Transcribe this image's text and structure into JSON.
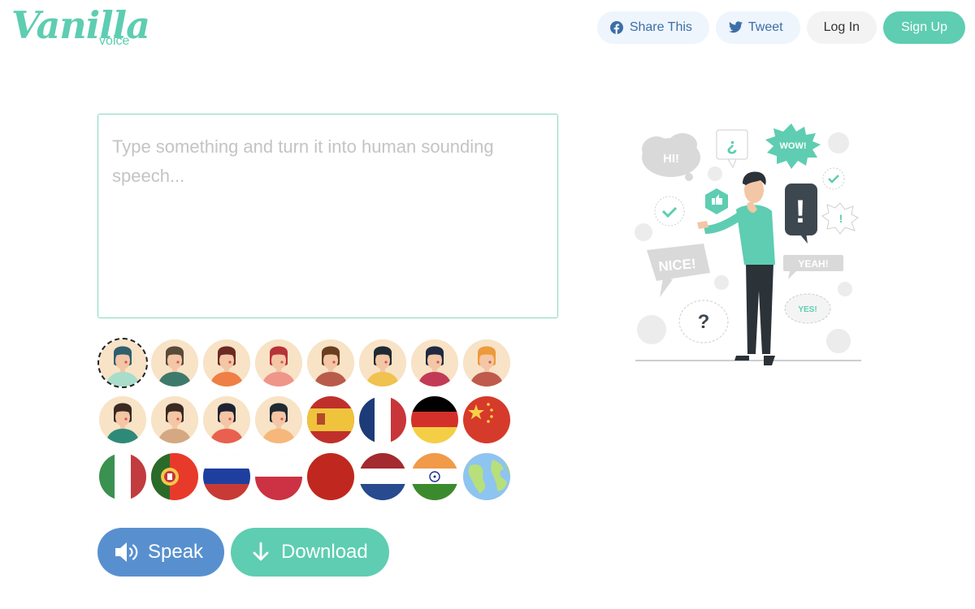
{
  "brand": {
    "name": "Vanilla",
    "tagline": "voice",
    "accent": "#5ecdb1"
  },
  "nav": {
    "share_label": "Share This",
    "tweet_label": "Tweet",
    "login_label": "Log In",
    "signup_label": "Sign Up"
  },
  "editor": {
    "value": "",
    "placeholder": "Type something and turn it into human sounding speech..."
  },
  "voices": {
    "selected_index": 0,
    "items": [
      {
        "kind": "avatar",
        "name": "woman-teal-hair",
        "hair": "#2f5f6e",
        "shirt": "#a9dccb"
      },
      {
        "kind": "avatar",
        "name": "man-green-shirt",
        "hair": "#5a4a3a",
        "shirt": "#3e7a6c"
      },
      {
        "kind": "avatar",
        "name": "woman-long-brown-hair",
        "hair": "#6b2a22",
        "shirt": "#ef7f44"
      },
      {
        "kind": "avatar",
        "name": "woman-red-bob",
        "hair": "#b8323a",
        "shirt": "#f0958a"
      },
      {
        "kind": "avatar",
        "name": "man-plaid-jacket",
        "hair": "#6a3e1f",
        "shirt": "#b95b4a"
      },
      {
        "kind": "avatar",
        "name": "man-yellow-jacket",
        "hair": "#1f2a33",
        "shirt": "#f0c24f"
      },
      {
        "kind": "avatar",
        "name": "man-glasses",
        "hair": "#1f2a40",
        "shirt": "#c23b56"
      },
      {
        "kind": "avatar",
        "name": "woman-orange-hair",
        "hair": "#ee9a3a",
        "shirt": "#c05a4c"
      },
      {
        "kind": "avatar",
        "name": "woman-short-dark-hair",
        "hair": "#3a2a22",
        "shirt": "#2e8a78"
      },
      {
        "kind": "avatar",
        "name": "man-tan-shirt",
        "hair": "#3a2a22",
        "shirt": "#d4a882"
      },
      {
        "kind": "avatar",
        "name": "woman-waving",
        "hair": "#1f2233",
        "shirt": "#e9604f"
      },
      {
        "kind": "avatar",
        "name": "man-orange-cardigan",
        "hair": "#1f2a33",
        "shirt": "#f5b87a"
      },
      {
        "kind": "flag",
        "name": "spain"
      },
      {
        "kind": "flag",
        "name": "france"
      },
      {
        "kind": "flag",
        "name": "germany"
      },
      {
        "kind": "flag",
        "name": "china"
      },
      {
        "kind": "flag",
        "name": "italy"
      },
      {
        "kind": "flag",
        "name": "portugal"
      },
      {
        "kind": "flag",
        "name": "russia"
      },
      {
        "kind": "flag",
        "name": "poland"
      },
      {
        "kind": "flag",
        "name": "japan"
      },
      {
        "kind": "flag",
        "name": "netherlands"
      },
      {
        "kind": "flag",
        "name": "india"
      },
      {
        "kind": "flag",
        "name": "world"
      }
    ]
  },
  "actions": {
    "speak_label": "Speak",
    "download_label": "Download"
  },
  "illustration": {
    "bubbles": [
      "HI!",
      "¿",
      "WOW!",
      "!",
      "NICE!",
      "YEAH!",
      "YES!",
      "?",
      "!"
    ]
  }
}
